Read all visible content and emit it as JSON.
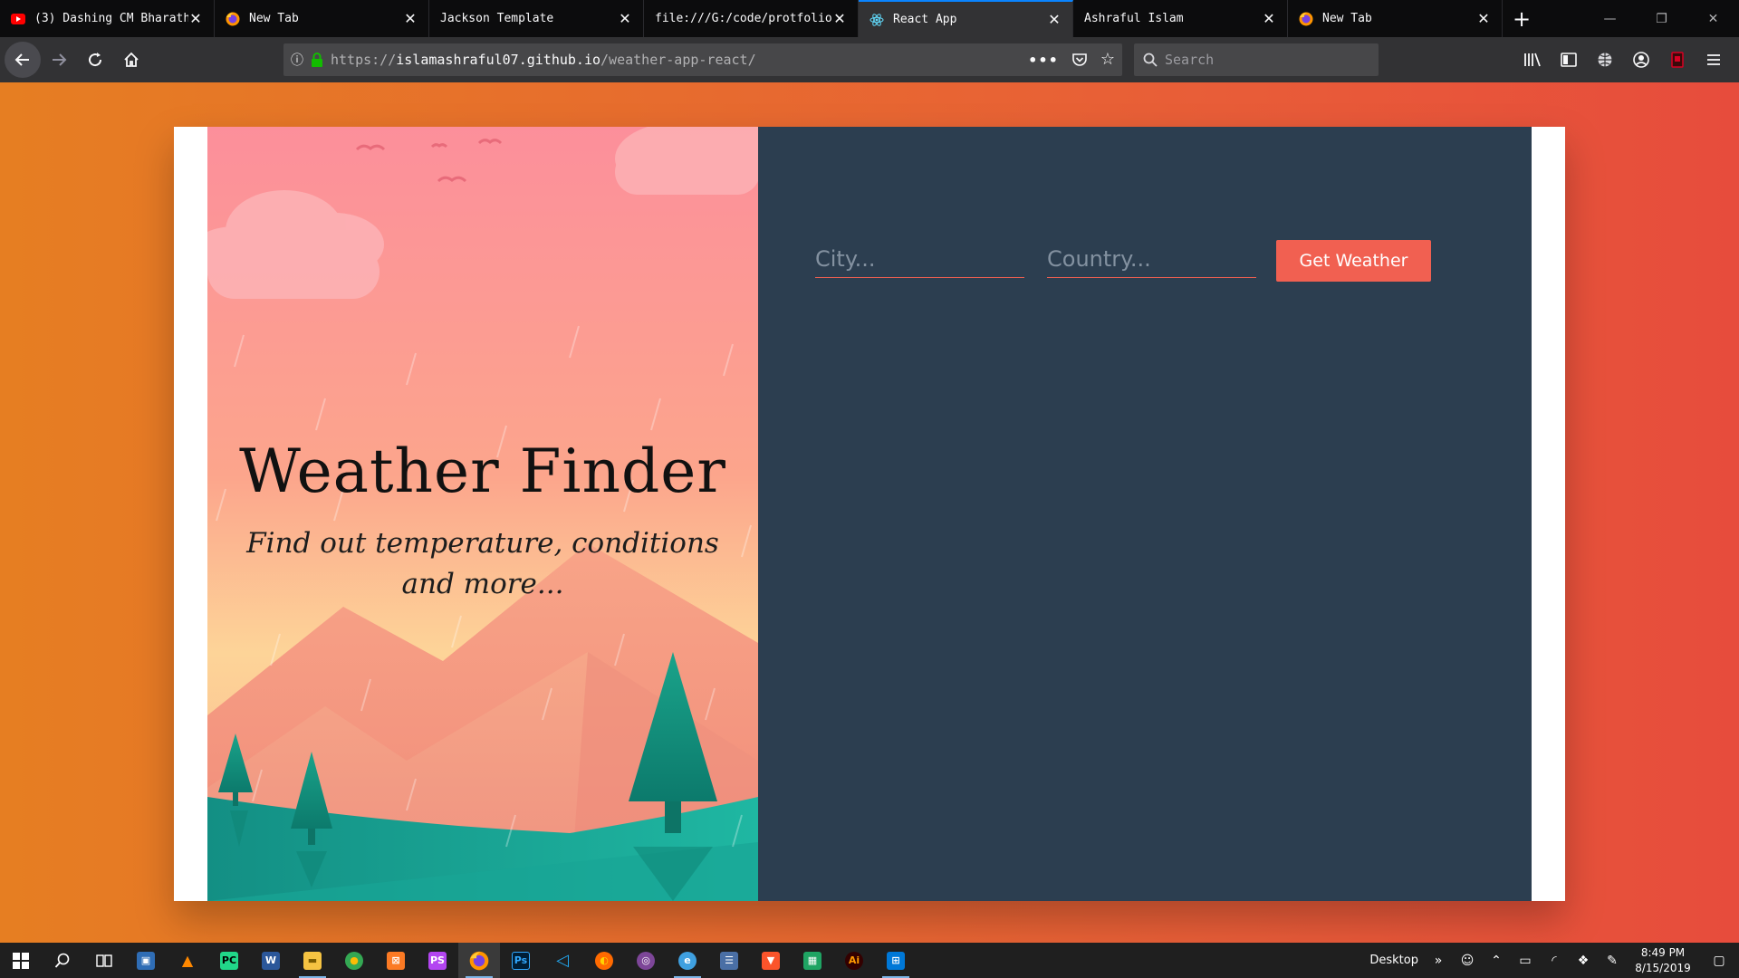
{
  "browser": {
    "tabs": [
      {
        "title": "(3) Dashing CM Bharath",
        "icon": "youtube-icon",
        "active": false
      },
      {
        "title": "New Tab",
        "icon": "firefox-icon",
        "active": false
      },
      {
        "title": "Jackson Template",
        "icon": "",
        "active": false
      },
      {
        "title": "file:///G:/code/protfolio",
        "icon": "",
        "active": false
      },
      {
        "title": "React App",
        "icon": "react-icon",
        "active": true
      },
      {
        "title": "Ashraful Islam",
        "icon": "",
        "active": false
      },
      {
        "title": "New Tab",
        "icon": "firefox-icon",
        "active": false
      }
    ],
    "new_tab_label": "+",
    "url_prefix": "https://",
    "url_host": "islamashraful07.github.io",
    "url_path": "/weather-app-react/",
    "search_placeholder": "Search",
    "accent": "#0a84ff"
  },
  "page": {
    "title": "Weather Finder",
    "subtitle": "Find out temperature, conditions and more...",
    "city_placeholder": "City...",
    "country_placeholder": "Country...",
    "button_label": "Get Weather",
    "colors": {
      "button": "#f16051",
      "panel": "#2c3e50",
      "background_start": "#e67e22",
      "background_end": "#e74c3c"
    }
  },
  "taskbar": {
    "desktop_label": "Desktop",
    "time": "8:49 PM",
    "date": "8/15/2019"
  }
}
